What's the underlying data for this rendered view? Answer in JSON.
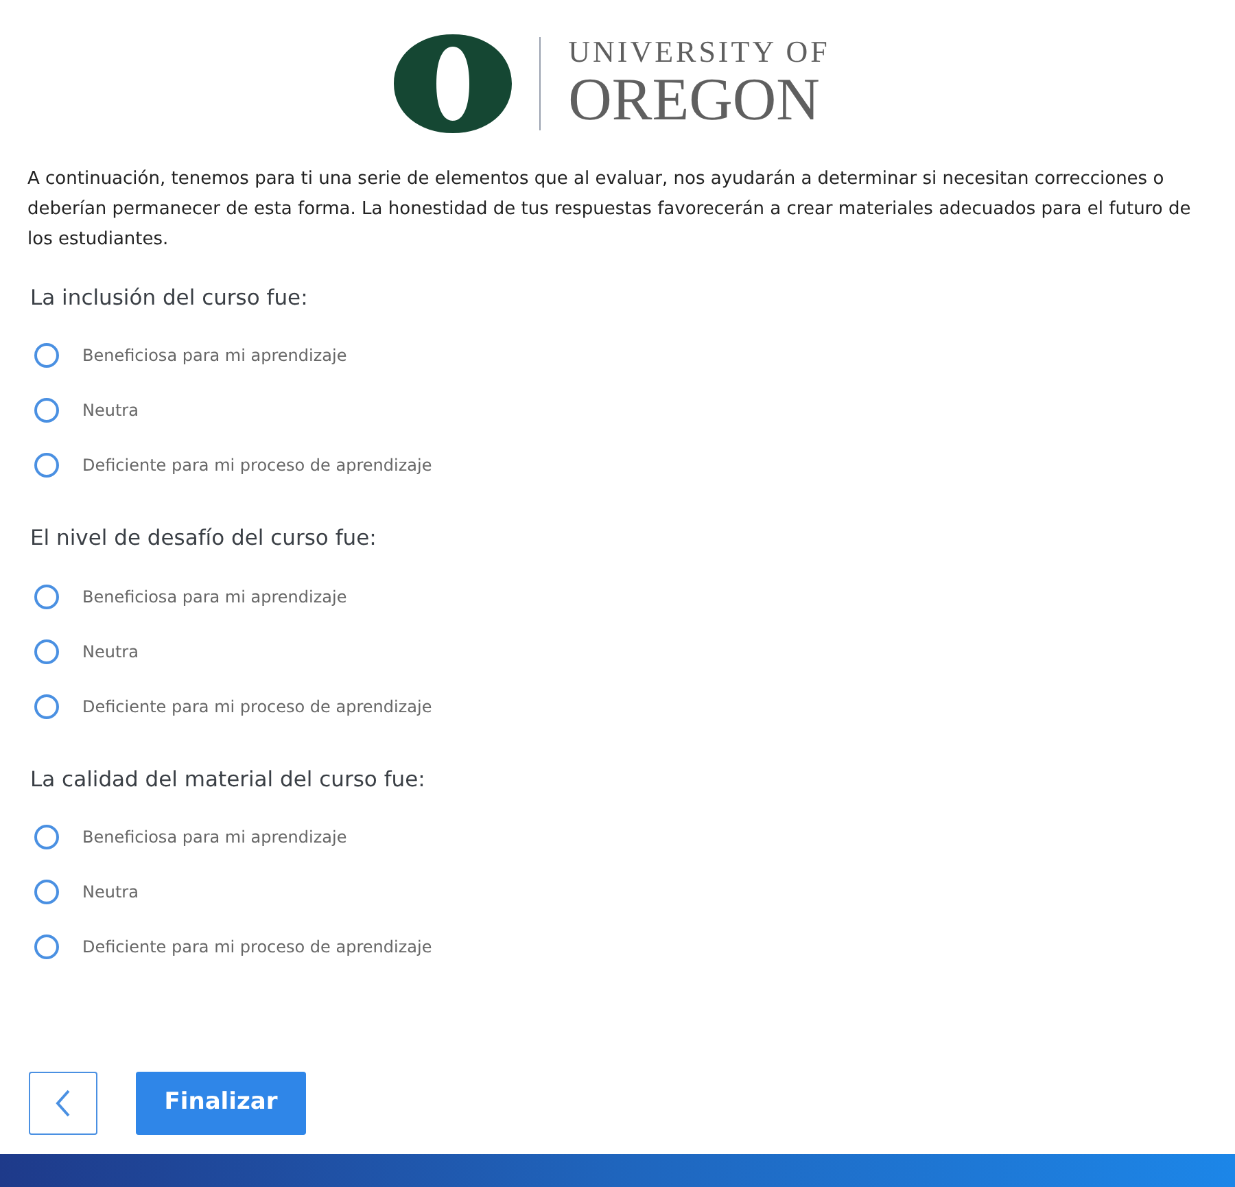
{
  "header": {
    "logo_line_1": "UNIVERSITY OF",
    "logo_line_2": "OREGON"
  },
  "intro": "A continuación, tenemos para ti una serie de elementos que al evaluar, nos ayudarán a determinar si necesitan correcciones o deberían permanecer de esta forma. La honestidad de tus respuestas favorecerán a crear materiales adecuados para el futuro de los estudiantes.",
  "questions": [
    {
      "title": "La inclusión del curso fue:",
      "options": [
        {
          "label": "Beneficiosa para mi aprendizaje",
          "selected": false
        },
        {
          "label": "Neutra",
          "selected": false
        },
        {
          "label": "Deficiente para mi proceso de aprendizaje",
          "selected": false
        }
      ]
    },
    {
      "title": "El nivel de desafío del curso fue:",
      "options": [
        {
          "label": "Beneficiosa para mi aprendizaje",
          "selected": false
        },
        {
          "label": "Neutra",
          "selected": false
        },
        {
          "label": "Deficiente para mi proceso de aprendizaje",
          "selected": false
        }
      ]
    },
    {
      "title": "La calidad del material del curso fue:",
      "options": [
        {
          "label": "Beneficiosa para mi aprendizaje",
          "selected": false
        },
        {
          "label": "Neutra",
          "selected": false
        },
        {
          "label": "Deficiente para mi proceso de aprendizaje",
          "selected": false
        }
      ]
    }
  ],
  "buttons": {
    "finish": "Finalizar"
  }
}
